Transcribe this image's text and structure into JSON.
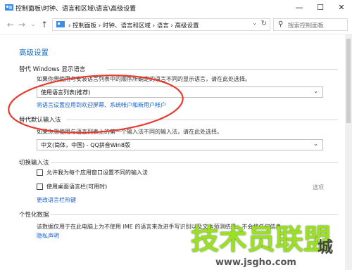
{
  "window": {
    "title": "控制面板\\时钟、语言和区域\\语言\\高级设置",
    "buttons": {
      "minimize": "—",
      "maximize": "☐",
      "close": "✕"
    }
  },
  "nav": {
    "back": "←",
    "forward": "→",
    "recent": "⌄",
    "up": "↑",
    "breadcrumbs": "›  控制面板  ›  时钟、语言和区域  ›  语言  ›  高级设置",
    "dropdown": "⌄",
    "refresh": "↻",
    "search_placeholder": "搜索控制面板",
    "search_icon": "⚲"
  },
  "content": {
    "heading": "高级设置",
    "display_language": {
      "title": "替代 Windows 显示语言",
      "description": "如果你想使用与安装语言列表中的顺序所确定的语言不同的显示语言，请在此处选择。",
      "selected": "使用语言列表(推荐)",
      "link": "将语言设置应用到欢迎屏幕、系统帐户和新用户帐户"
    },
    "input_method": {
      "title": "替代默认输入法",
      "description": "如果你想使用与语言列表上的第一个输入法不同的输入法，请在此处选择。",
      "selected": "中文(简体，中国) - QQ拼音Win8版"
    },
    "switch_input": {
      "title": "切换输入法",
      "option1": "允许我为每个应用窗口设置不同的输入法",
      "option2": "使用桌面语言栏(可用时)",
      "option2_link": "选项",
      "hotkey_link": "更改语言栏热键"
    },
    "personalization": {
      "title": "个性化数据",
      "description": "该数据仅用于在此电脑上为不使用 IME 的语言来改进手写识别以及文本预测结果。不会将任何信息",
      "privacy_link": "隐私声明"
    }
  },
  "watermark": {
    "brand": "技术员联盟",
    "brand_tail": "城",
    "url": "www.jsgho.com"
  },
  "colors": {
    "heading": "#1e6fb9",
    "link": "#1b62c8",
    "annotation": "#e53b2e",
    "watermark": "#9be022"
  }
}
